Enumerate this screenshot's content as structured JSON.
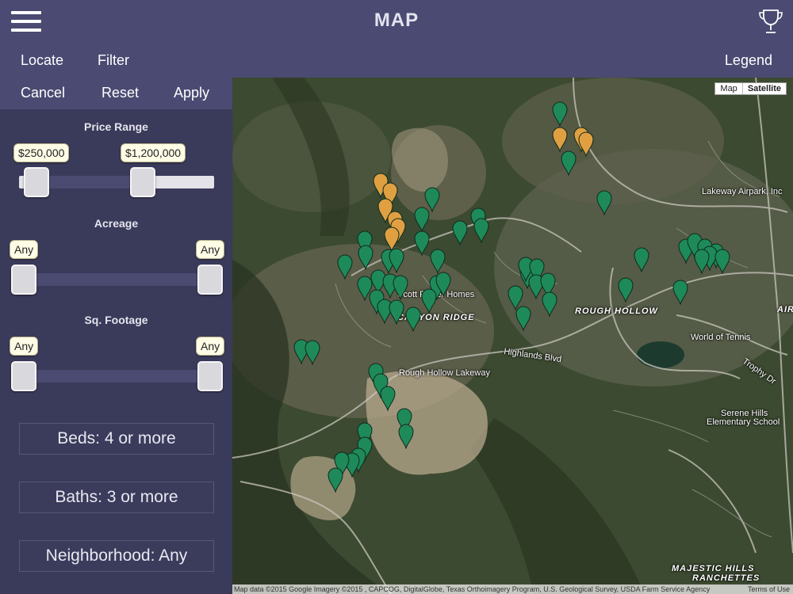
{
  "header": {
    "title": "MAP"
  },
  "toolbar": {
    "locate": "Locate",
    "filter": "Filter",
    "legend": "Legend"
  },
  "filter_actions": {
    "cancel": "Cancel",
    "reset": "Reset",
    "apply": "Apply"
  },
  "price_range": {
    "label": "Price Range",
    "min_value": "$250,000",
    "max_value": "$1,200,000",
    "min_fraction": 0.09,
    "max_fraction": 0.64
  },
  "acreage": {
    "label": "Acreage",
    "min_value": "Any",
    "max_value": "Any"
  },
  "sq_footage": {
    "label": "Sq. Footage",
    "min_value": "Any",
    "max_value": "Any"
  },
  "beds": {
    "label": "Beds: 4 or more"
  },
  "baths": {
    "label": "Baths: 3 or more"
  },
  "neighborhood": {
    "label": "Neighborhood: Any"
  },
  "map": {
    "toggle_map": "Map",
    "toggle_satellite": "Satellite",
    "selected_type": "Satellite",
    "labels": {
      "scott_homes": "Scott Felder Homes",
      "canyon_ridge": "CANYON RIDGE",
      "rough_hollow": "ROUGH HOLLOW",
      "highlands_blvd": "Highlands Blvd",
      "rough_hollow_lakeway": "Rough Hollow Lakeway",
      "lakeway_airpark": "Lakeway Airpark, Inc",
      "world_of_tennis": "World of Tennis",
      "trophy_dr": "Trophy Dr",
      "serene_hills": "Serene Hills",
      "elementary_school": "Elementary School",
      "majestic_hills": "MAJESTIC HILLS",
      "ranchettes": "RANCHETTES",
      "airp": "AIRP"
    },
    "attribution": "Map data ©2015 Google Imagery ©2015 , CAPCOG, DigitalGlobe, Texas Orthoimagery Program, U.S. Geological Survey, USDA Farm Service Agency",
    "terms": "Terms of Use",
    "colors": {
      "green_pin": "#1e8a5a",
      "orange_pin": "#e0a042"
    }
  }
}
